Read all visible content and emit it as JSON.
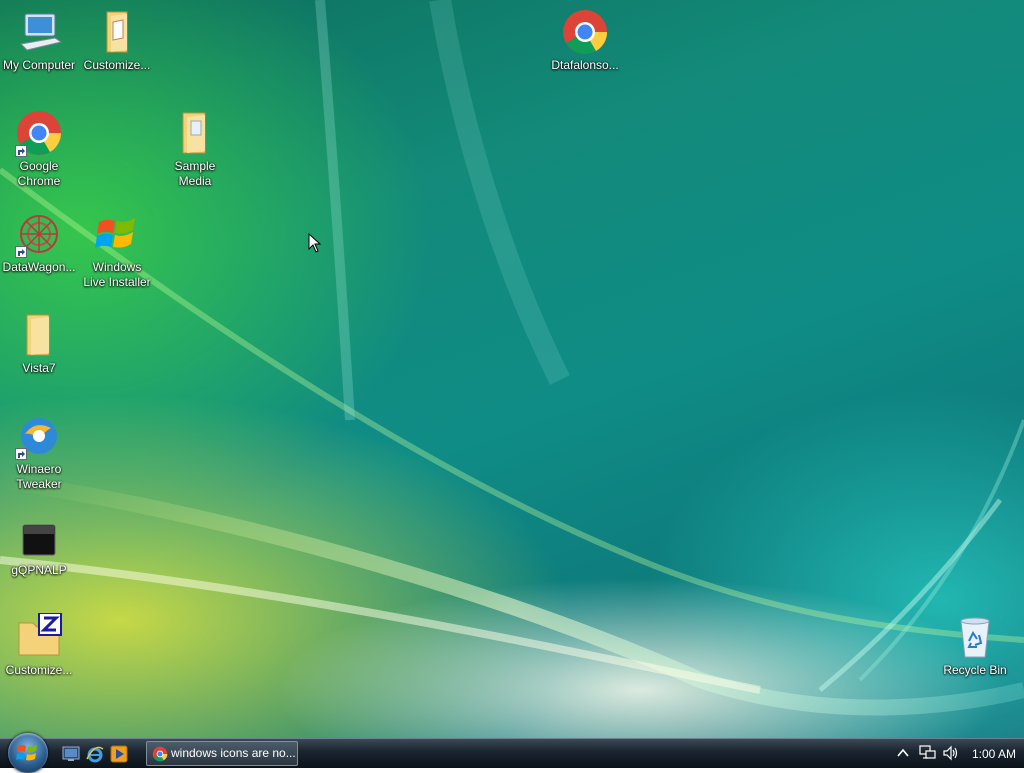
{
  "desktop": {
    "icons": [
      {
        "label": "My Computer",
        "icon": "computer-icon"
      },
      {
        "label": "Customize...",
        "icon": "folder-icon"
      },
      {
        "label": "Dtafalonso...",
        "icon": "chrome-icon"
      },
      {
        "label": "Google Chrome",
        "icon": "chrome-shortcut-icon"
      },
      {
        "label": "Sample Media",
        "icon": "folder-icon"
      },
      {
        "label": "DataWagon...",
        "icon": "datawagon-shortcut-icon"
      },
      {
        "label": "Windows Live Installer",
        "icon": "windows-logo-icon"
      },
      {
        "label": "Vista7",
        "icon": "folder-icon"
      },
      {
        "label": "Winaero Tweaker",
        "icon": "winaero-shortcut-icon"
      },
      {
        "label": "gQPNALP",
        "icon": "black-app-icon"
      },
      {
        "label": "Customize...",
        "icon": "zip-folder-icon"
      },
      {
        "label": "Recycle Bin",
        "icon": "recycle-bin-icon"
      }
    ]
  },
  "taskbar": {
    "start_icon": "start-orb-icon",
    "quicklaunch": [
      "show-desktop-icon",
      "internet-explorer-icon",
      "media-player-icon"
    ],
    "task_button_label": "windows icons are no...",
    "tray": [
      "show-hidden-icons-icon",
      "network-icon",
      "volume-icon"
    ],
    "clock": "1:00 AM"
  }
}
